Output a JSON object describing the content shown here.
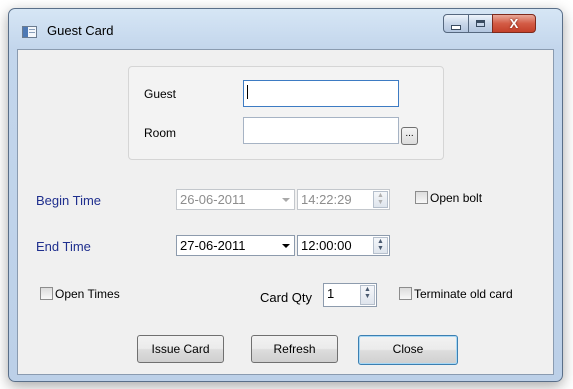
{
  "window": {
    "title": "Guest Card",
    "controls": {
      "minimize_icon": "minimize-icon",
      "maximize_icon": "maximize-icon",
      "close_glyph": "X"
    }
  },
  "guest_group": {
    "guest_label": "Guest",
    "guest_value": "",
    "room_label": "Room",
    "room_value": "",
    "browse_label": "..."
  },
  "begin": {
    "label": "Begin Time",
    "date": "26-06-2011",
    "time": "14:22:29",
    "enabled": false
  },
  "open_bolt": {
    "label": "Open bolt",
    "checked": false
  },
  "end": {
    "label": "End Time",
    "date": "27-06-2011",
    "time": "12:00:00",
    "enabled": true
  },
  "open_times": {
    "label": "Open Times",
    "checked": false
  },
  "card_qty": {
    "label": "Card Qty",
    "value": "1"
  },
  "terminate_old": {
    "label": "Terminate old card",
    "checked": false
  },
  "buttons": {
    "issue": "Issue Card",
    "refresh": "Refresh",
    "close": "Close"
  },
  "colors": {
    "label_blue": "#1f2f8e",
    "close_red": "#c3402a",
    "focus_border": "#3d7bc3"
  }
}
